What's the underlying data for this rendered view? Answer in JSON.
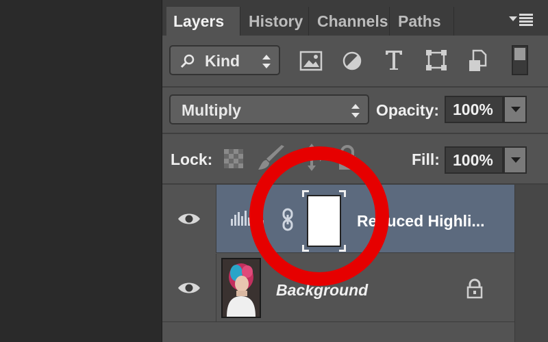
{
  "tabs": [
    {
      "label": "Layers",
      "active": true
    },
    {
      "label": "History",
      "active": false
    },
    {
      "label": "Channels",
      "active": false
    },
    {
      "label": "Paths",
      "active": false
    }
  ],
  "filter": {
    "label": "Kind"
  },
  "blend": {
    "mode": "Multiply",
    "opacity_label": "Opacity:",
    "opacity_value": "100%"
  },
  "lock": {
    "label": "Lock:",
    "fill_label": "Fill:",
    "fill_value": "100%"
  },
  "layers": [
    {
      "name": "Reduced Highli...",
      "type": "adjustment-levels",
      "selected": true,
      "visible": true
    },
    {
      "name": "Background",
      "type": "image",
      "selected": false,
      "visible": true,
      "locked": true
    }
  ],
  "colors": {
    "selected_row": "#5c6a7e",
    "panel_bg": "#535353",
    "annotation_ring": "#e60000"
  }
}
